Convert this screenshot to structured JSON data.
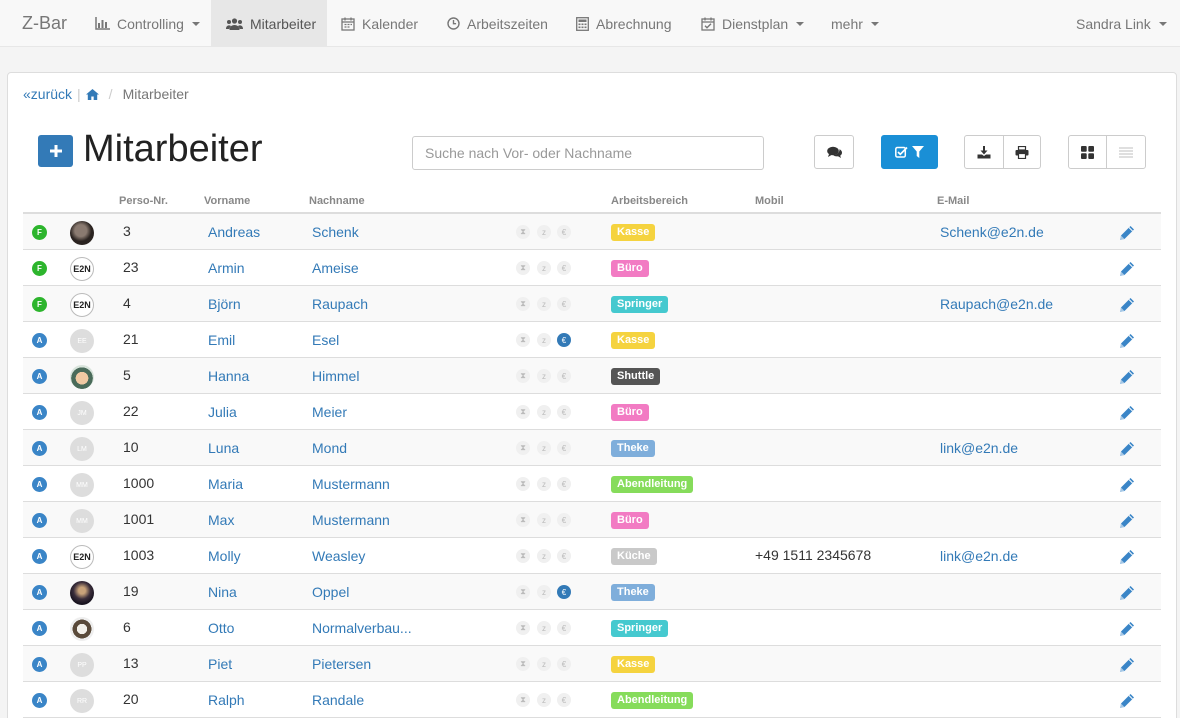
{
  "nav": {
    "brand": "Z-Bar",
    "items": [
      {
        "label": "Controlling",
        "icon": "bar-chart-icon",
        "dropdown": true
      },
      {
        "label": "Mitarbeiter",
        "icon": "users-icon",
        "active": true
      },
      {
        "label": "Kalender",
        "icon": "calendar-icon"
      },
      {
        "label": "Arbeitszeiten",
        "icon": "clock-icon"
      },
      {
        "label": "Abrechnung",
        "icon": "calculator-icon"
      },
      {
        "label": "Dienstplan",
        "icon": "calendar-check-icon",
        "dropdown": true
      },
      {
        "label": "mehr",
        "dropdown": true
      }
    ],
    "user": "Sandra Link"
  },
  "breadcrumb": {
    "back": "zurück",
    "current": "Mitarbeiter"
  },
  "page": {
    "title": "Mitarbeiter"
  },
  "search": {
    "placeholder": "Suche nach Vor- oder Nachname",
    "value": ""
  },
  "columns": {
    "persno": "Perso-Nr.",
    "vorname": "Vorname",
    "nachname": "Nachname",
    "bereich": "Arbeitsbereich",
    "mobil": "Mobil",
    "email": "E-Mail"
  },
  "indicator_glyphs": {
    "hourglass": "⧗",
    "z": "z",
    "euro": "€"
  },
  "avatar_logo_text": "E2N",
  "status_colors": {
    "F": "#2db52d",
    "A": "#3a85c7"
  },
  "badge_colors": {
    "Kasse": "#f5d33f",
    "Büro": "#f27bc3",
    "Springer": "#45c9cf",
    "Shuttle": "#555555",
    "Theke": "#7faedb",
    "Abendleitung": "#86dc5b",
    "Küche": "#c9c9c9"
  },
  "employees": [
    {
      "status": "F",
      "avatar": "photo-dark",
      "initials": "",
      "persno": "3",
      "vorname": "Andreas",
      "nachname": "Schenk",
      "euro_active": false,
      "bereich": "Kasse",
      "mobil": "",
      "email": "Schenk@e2n.de"
    },
    {
      "status": "F",
      "avatar": "logo",
      "initials": "",
      "persno": "23",
      "vorname": "Armin",
      "nachname": "Ameise",
      "euro_active": false,
      "bereich": "Büro",
      "mobil": "",
      "email": ""
    },
    {
      "status": "F",
      "avatar": "logo",
      "initials": "",
      "persno": "4",
      "vorname": "Björn",
      "nachname": "Raupach",
      "euro_active": false,
      "bereich": "Springer",
      "mobil": "",
      "email": "Raupach@e2n.de"
    },
    {
      "status": "A",
      "avatar": "ph",
      "initials": "EE",
      "persno": "21",
      "vorname": "Emil",
      "nachname": "Esel",
      "euro_active": true,
      "bereich": "Kasse",
      "mobil": "",
      "email": ""
    },
    {
      "status": "A",
      "avatar": "photo-cartoon",
      "initials": "",
      "persno": "5",
      "vorname": "Hanna",
      "nachname": "Himmel",
      "euro_active": false,
      "bereich": "Shuttle",
      "mobil": "",
      "email": ""
    },
    {
      "status": "A",
      "avatar": "ph",
      "initials": "JM",
      "persno": "22",
      "vorname": "Julia",
      "nachname": "Meier",
      "euro_active": false,
      "bereich": "Büro",
      "mobil": "",
      "email": ""
    },
    {
      "status": "A",
      "avatar": "ph",
      "initials": "LM",
      "persno": "10",
      "vorname": "Luna",
      "nachname": "Mond",
      "euro_active": false,
      "bereich": "Theke",
      "mobil": "",
      "email": "link@e2n.de"
    },
    {
      "status": "A",
      "avatar": "ph",
      "initials": "MM",
      "persno": "1000",
      "vorname": "Maria",
      "nachname": "Mustermann",
      "euro_active": false,
      "bereich": "Abendleitung",
      "mobil": "",
      "email": ""
    },
    {
      "status": "A",
      "avatar": "ph",
      "initials": "MM",
      "persno": "1001",
      "vorname": "Max",
      "nachname": "Mustermann",
      "euro_active": false,
      "bereich": "Büro",
      "mobil": "",
      "email": ""
    },
    {
      "status": "A",
      "avatar": "logo",
      "initials": "",
      "persno": "1003",
      "vorname": "Molly",
      "nachname": "Weasley",
      "euro_active": false,
      "bereich": "Küche",
      "mobil": "+49 1511 2345678",
      "email": "link@e2n.de"
    },
    {
      "status": "A",
      "avatar": "photo-space",
      "initials": "",
      "persno": "19",
      "vorname": "Nina",
      "nachname": "Oppel",
      "euro_active": true,
      "bereich": "Theke",
      "mobil": "",
      "email": ""
    },
    {
      "status": "A",
      "avatar": "photo-skull",
      "initials": "",
      "persno": "6",
      "vorname": "Otto",
      "nachname": "Normalverbau...",
      "euro_active": false,
      "bereich": "Springer",
      "mobil": "",
      "email": ""
    },
    {
      "status": "A",
      "avatar": "ph",
      "initials": "PP",
      "persno": "13",
      "vorname": "Piet",
      "nachname": "Pietersen",
      "euro_active": false,
      "bereich": "Kasse",
      "mobil": "",
      "email": ""
    },
    {
      "status": "A",
      "avatar": "ph",
      "initials": "RR",
      "persno": "20",
      "vorname": "Ralph",
      "nachname": "Randale",
      "euro_active": false,
      "bereich": "Abendleitung",
      "mobil": "",
      "email": ""
    }
  ]
}
